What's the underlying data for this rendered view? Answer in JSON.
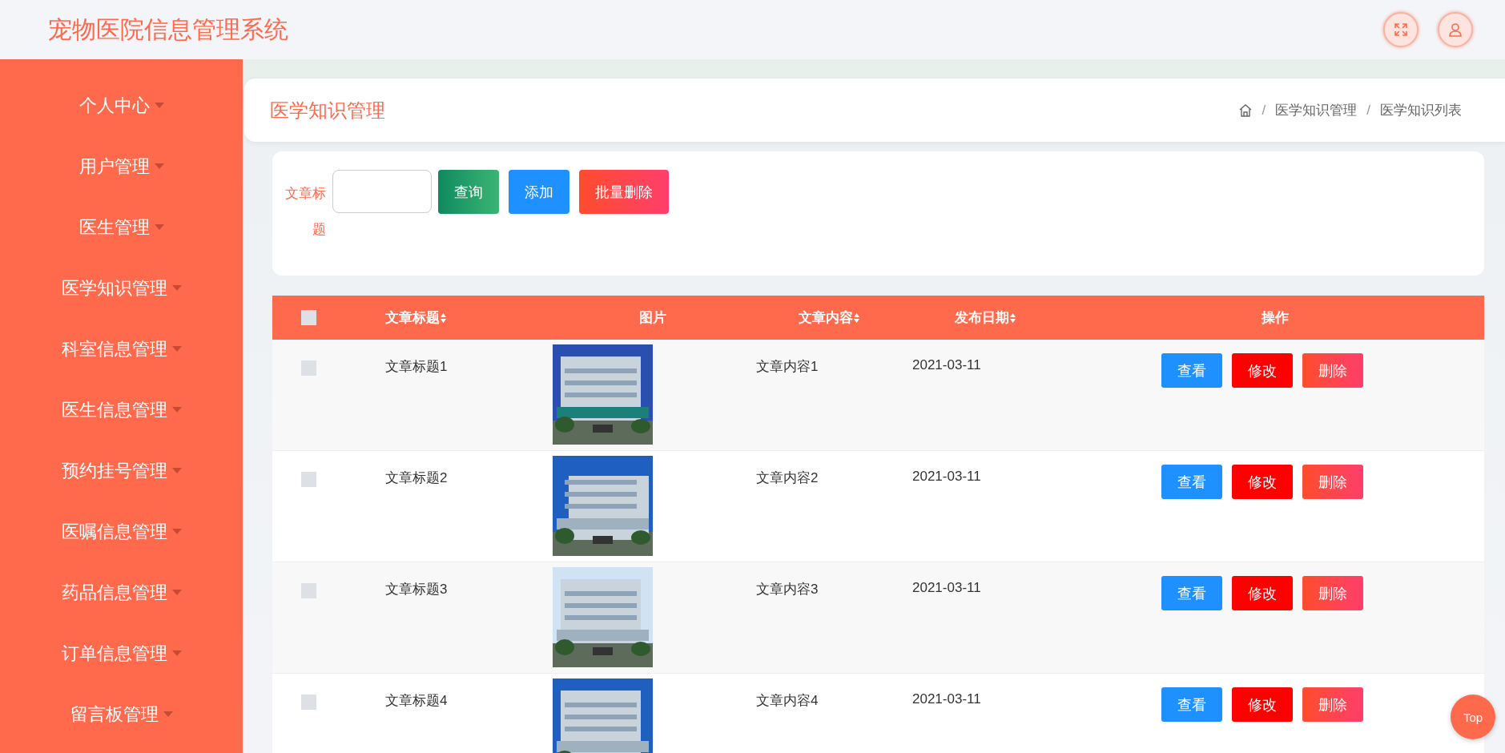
{
  "header": {
    "title": "宠物医院信息管理系统"
  },
  "sidebar": {
    "items": [
      {
        "label": "个人中心"
      },
      {
        "label": "用户管理"
      },
      {
        "label": "医生管理"
      },
      {
        "label": "医学知识管理"
      },
      {
        "label": "科室信息管理"
      },
      {
        "label": "医生信息管理"
      },
      {
        "label": "预约挂号管理"
      },
      {
        "label": "医嘱信息管理"
      },
      {
        "label": "药品信息管理"
      },
      {
        "label": "订单信息管理"
      },
      {
        "label": "留言板管理"
      }
    ]
  },
  "page_header": {
    "title": "医学知识管理",
    "breadcrumb": [
      "医学知识管理",
      "医学知识列表"
    ],
    "separator": "/"
  },
  "search": {
    "label_line1": "文章标",
    "label_line2": "题",
    "buttons": [
      {
        "kind": "query",
        "label": "查询"
      },
      {
        "kind": "add",
        "label": "添加"
      },
      {
        "kind": "batch_delete",
        "label": "批量删除"
      }
    ]
  },
  "table": {
    "select_all_checked": false,
    "columns": [
      {
        "label": "文章标题",
        "sortable": true
      },
      {
        "label": "图片",
        "sortable": false
      },
      {
        "label": "文章内容",
        "sortable": true
      },
      {
        "label": "发布日期",
        "sortable": true
      },
      {
        "label": "操作",
        "sortable": false
      }
    ],
    "rows": [
      {
        "checked": false,
        "title": "文章标题1",
        "image": {
          "kind": "picture"
        },
        "content": "文章内容1",
        "date": "2021-03-11",
        "actions": [
          "查看",
          "修改",
          "删除"
        ]
      },
      {
        "checked": false,
        "title": "文章标题2",
        "image": {
          "kind": "picture"
        },
        "content": "文章内容2",
        "date": "2021-03-11",
        "actions": [
          "查看",
          "修改",
          "删除"
        ]
      },
      {
        "checked": false,
        "title": "文章标题3",
        "image": {
          "kind": "picture"
        },
        "content": "文章内容3",
        "date": "2021-03-11",
        "actions": [
          "查看",
          "修改",
          "删除"
        ]
      },
      {
        "checked": false,
        "title": "文章标题4",
        "image": {
          "kind": "picture"
        },
        "content": "文章内容4",
        "date": "2021-03-11",
        "actions": [
          "查看",
          "修改",
          "删除"
        ]
      }
    ]
  },
  "back_to_top": {
    "label": "Top"
  }
}
